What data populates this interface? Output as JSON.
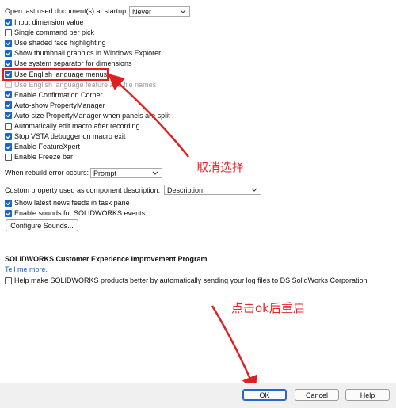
{
  "startup": {
    "label": "Open last used document(s) at startup:",
    "value": "Never"
  },
  "options": [
    {
      "label": "Input dimension value",
      "checked": true
    },
    {
      "label": "Single command per pick",
      "checked": false
    },
    {
      "label": "Use shaded face highlighting",
      "checked": true
    },
    {
      "label": "Show thumbnail graphics in Windows Explorer",
      "checked": true
    },
    {
      "label": "Use system separator for dimensions",
      "checked": true
    },
    {
      "label": "Use English language menus",
      "checked": true
    },
    {
      "label": "Use English language feature and file names",
      "checked": false,
      "disabled": true
    },
    {
      "label": "Enable Confirmation Corner",
      "checked": true
    },
    {
      "label": "Auto-show PropertyManager",
      "checked": true
    },
    {
      "label": "Auto-size PropertyManager when panels are split",
      "checked": true
    },
    {
      "label": "Automatically edit macro after recording",
      "checked": false
    },
    {
      "label": "Stop VSTA debugger on macro exit",
      "checked": true
    },
    {
      "label": "Enable FeatureXpert",
      "checked": true
    },
    {
      "label": "Enable Freeze bar",
      "checked": false
    }
  ],
  "rebuild": {
    "label": "When rebuild error occurs:",
    "value": "Prompt"
  },
  "custom_property": {
    "label": "Custom property used as component description:",
    "value": "Description"
  },
  "news": {
    "label": "Show latest news feeds in task pane",
    "checked": true
  },
  "sounds": {
    "label": "Enable sounds for SOLIDWORKS events",
    "checked": true
  },
  "configure_sounds": "Configure Sounds...",
  "ceip": {
    "title": "SOLIDWORKS Customer Experience Improvement Program",
    "link": "Tell me more.",
    "help_label": "Help make SOLIDWORKS products better by automatically sending your log files to DS SolidWorks Corporation",
    "help_checked": false
  },
  "buttons": {
    "ok": "OK",
    "cancel": "Cancel",
    "help": "Help"
  },
  "annotations": {
    "deselect": "取消选择",
    "click_ok": "点击ok后重启"
  },
  "colors": {
    "accent": "#1b65c5",
    "annotation": "#e02020"
  }
}
